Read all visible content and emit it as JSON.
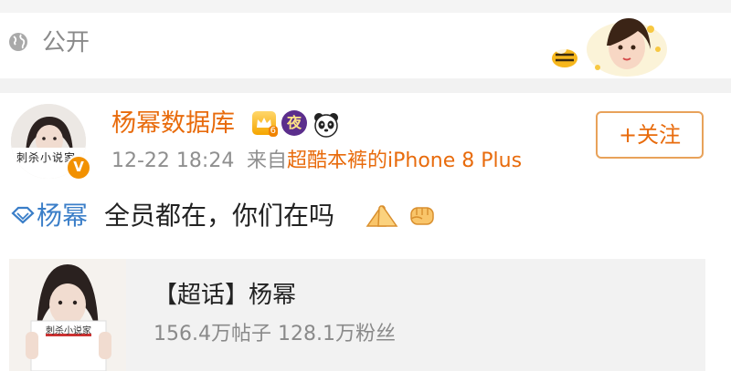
{
  "visibility": {
    "label": "公开",
    "icon": "globe-icon"
  },
  "post": {
    "user_name": "杨幂数据库",
    "crown_level": "6",
    "night_badge": "夜",
    "time": "12-22 18:24",
    "source_prefix": "来自",
    "source": "超酷本裤的iPhone 8 Plus",
    "follow_label": "+关注",
    "topic_name": "杨幂",
    "text": "全员都在，你们在吗",
    "avatar_caption": "刺杀小说家"
  },
  "card": {
    "title": "【超话】杨幂",
    "stats": "156.4万帖子 128.1万粉丝",
    "book_caption": "刺杀小说家"
  },
  "colors": {
    "accent": "#e86b0c",
    "link": "#3a7ec8",
    "muted": "#8f8f8f"
  }
}
